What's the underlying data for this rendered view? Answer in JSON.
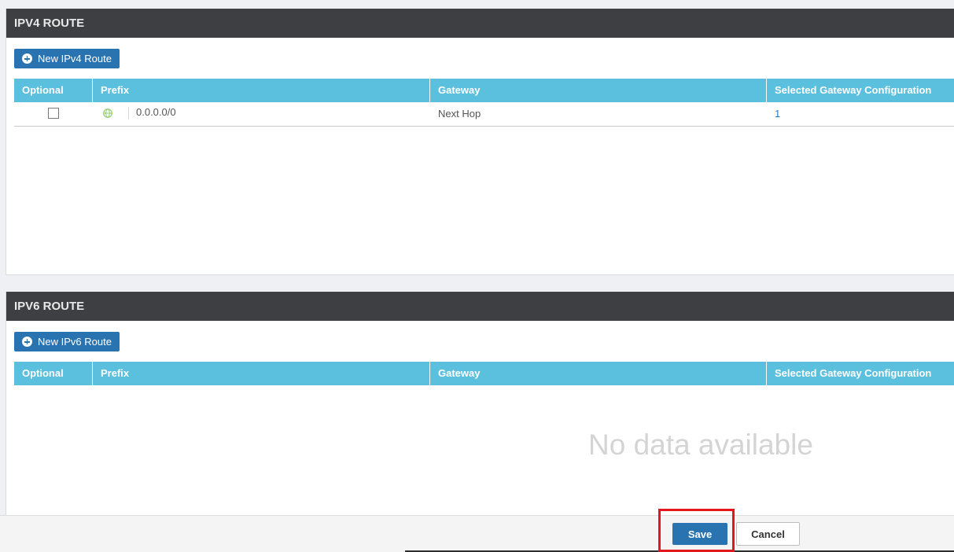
{
  "ipv4": {
    "title": "IPV4 ROUTE",
    "new_button": "New IPv4 Route",
    "columns": [
      "Optional",
      "Prefix",
      "Gateway",
      "Selected Gateway Configuration"
    ],
    "rows": [
      {
        "optional": false,
        "prefix": "0.0.0.0/0",
        "gateway": "Next Hop",
        "config": "1"
      }
    ]
  },
  "ipv6": {
    "title": "IPV6 ROUTE",
    "new_button": "New IPv6 Route",
    "columns": [
      "Optional",
      "Prefix",
      "Gateway",
      "Selected Gateway Configuration"
    ],
    "empty_message": "No data available"
  },
  "footer": {
    "save_label": "Save",
    "cancel_label": "Cancel"
  },
  "colors": {
    "header_bg": "#3e3f42",
    "table_header_bg": "#5bc0de",
    "primary_button": "#2873b0",
    "highlight": "#e2161b",
    "globe": "#8ccf6a"
  },
  "icons": {
    "new_button_icon": "plus-circle-icon",
    "prefix_icon": "globe-icon"
  }
}
